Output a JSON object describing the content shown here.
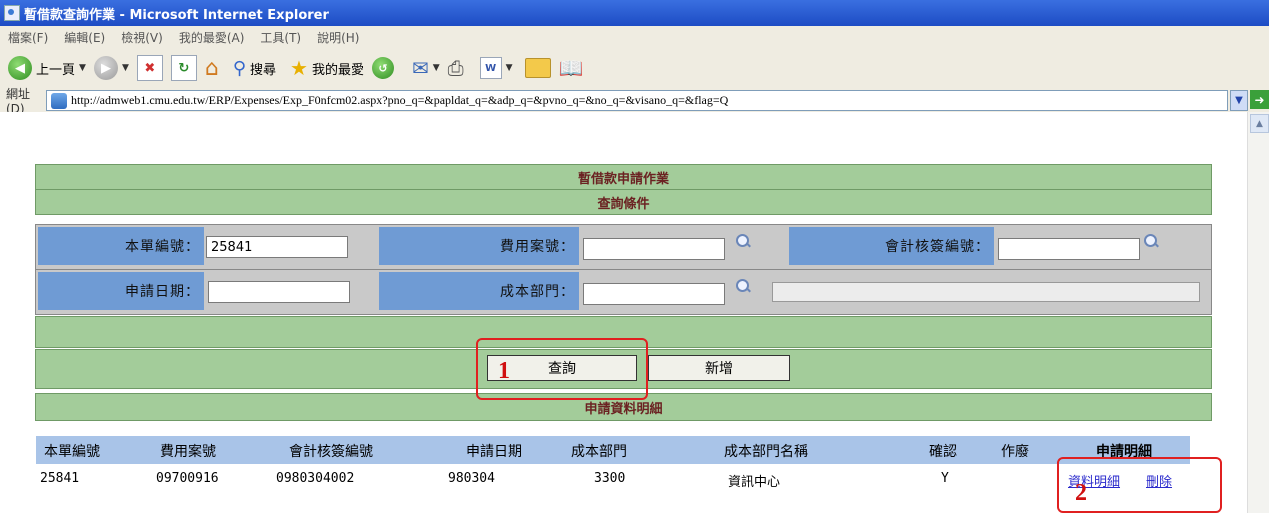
{
  "window": {
    "title": "暫借款查詢作業 - Microsoft Internet Explorer"
  },
  "menu": [
    "檔案(F)",
    "編輯(E)",
    "檢視(V)",
    "我的最愛(A)",
    "工具(T)",
    "說明(H)"
  ],
  "toolbar": {
    "back_label": "上一頁",
    "search_label": "搜尋",
    "favorites_label": "我的最愛"
  },
  "address": {
    "label": "網址(D)",
    "url": "http://admweb1.cmu.edu.tw/ERP/Expenses/Exp_F0nfcm02.aspx?pno_q=&papldat_q=&adp_q=&pvno_q=&no_q=&visano_q=&flag=Q",
    "go_label": "移"
  },
  "page": {
    "title": "暫借款申請作業",
    "section_query": "查詢條件",
    "section_detail": "申請資料明細"
  },
  "form": {
    "order_no": {
      "label": "本單編號：",
      "value": "25841"
    },
    "expense_no": {
      "label": "費用案號：",
      "value": ""
    },
    "accounting_no": {
      "label": "會計核簽編號：",
      "value": ""
    },
    "apply_date": {
      "label": "申請日期：",
      "value": ""
    },
    "cost_dept": {
      "label": "成本部門：",
      "value": "",
      "name_value": ""
    }
  },
  "buttons": {
    "query": "查詢",
    "add": "新增"
  },
  "annotations": {
    "one": "1",
    "two": "2"
  },
  "table": {
    "headers": [
      "本單編號",
      "費用案號",
      "會計核簽編號",
      "申請日期",
      "成本部門",
      "成本部門名稱",
      "確認",
      "作廢",
      "申請明細"
    ],
    "rows": [
      {
        "order_no": "25841",
        "expense_no": "09700916",
        "accounting_no": "0980304002",
        "apply_date": "980304",
        "cost_dept": "3300",
        "dept_name": "資訊中心",
        "confirm": "Y",
        "void": "",
        "detail_link": "資料明細",
        "delete_link": "刪除"
      }
    ]
  }
}
